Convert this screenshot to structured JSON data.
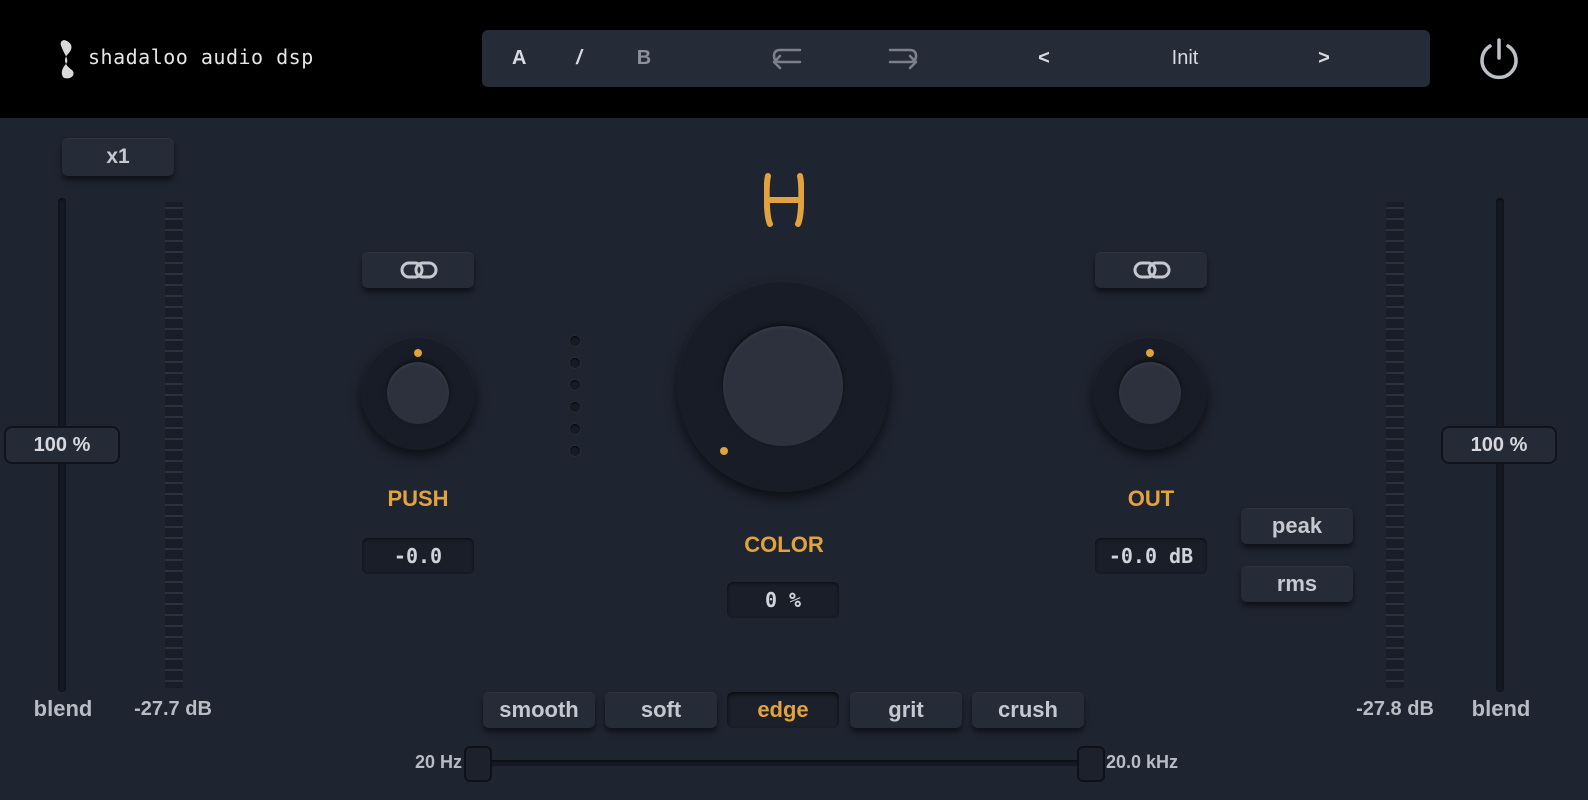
{
  "brand": {
    "name": "shadaloo audio dsp"
  },
  "preset_bar": {
    "a_label": "A",
    "sep_label": "/",
    "b_label": "B",
    "undo_icon": "undo-icon",
    "redo_icon": "redo-icon",
    "prev_label": "<",
    "preset_name": "Init",
    "next_label": ">"
  },
  "power_icon": "power-icon",
  "oversample": {
    "label": "x1"
  },
  "left": {
    "blend_value": "100 %",
    "blend_label": "blend",
    "meter_value": "-27.7 dB"
  },
  "right": {
    "blend_value": "100 %",
    "blend_label": "blend",
    "meter_value": "-27.8 dB"
  },
  "push": {
    "label": "PUSH",
    "value": "-0.0"
  },
  "color": {
    "label": "COLOR",
    "value": "0 %"
  },
  "out": {
    "label": "OUT",
    "value": "-0.0 dB"
  },
  "meter_mode": {
    "peak": "peak",
    "rms": "rms"
  },
  "modes": {
    "items": [
      "smooth",
      "soft",
      "edge",
      "grit",
      "crush"
    ],
    "selected": "edge"
  },
  "filter": {
    "low_label": "20 Hz",
    "high_label": "20.0 kHz"
  },
  "colors": {
    "accent": "#e2a23d",
    "background": "#1f2431",
    "topbar": "#000000"
  }
}
